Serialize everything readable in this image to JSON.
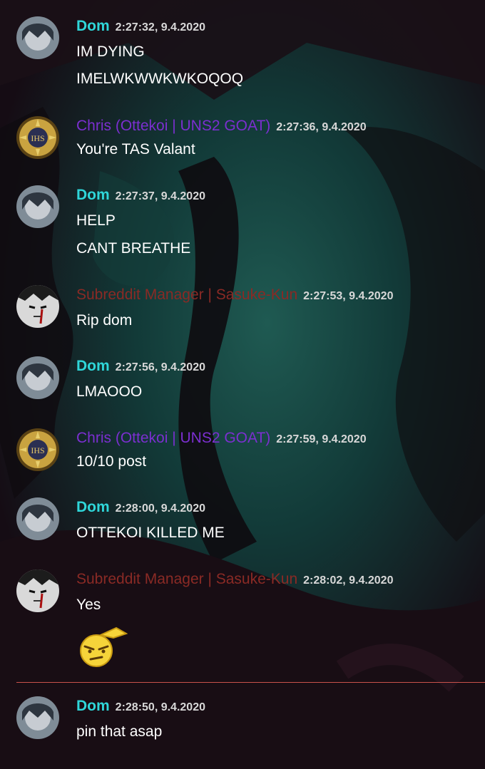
{
  "messages": [
    {
      "author": "Dom",
      "time": "2:27:32, 9.4.2020",
      "lines": [
        "IM DYING",
        "IMELWKWWKWKOQOQ"
      ]
    },
    {
      "author": "Chris (Ottekoi | UNS2 GOAT)",
      "time": "2:27:36, 9.4.2020",
      "lines": [
        "You're TAS Valant"
      ]
    },
    {
      "author": "Dom",
      "time": "2:27:37, 9.4.2020",
      "lines": [
        "HELP",
        "CANT BREATHE"
      ]
    },
    {
      "author": "Subreddit Manager | Sasuke-Kun",
      "time": "2:27:53, 9.4.2020",
      "lines": [
        "Rip dom"
      ]
    },
    {
      "author": "Dom",
      "time": "2:27:56, 9.4.2020",
      "lines": [
        "LMAOOO"
      ]
    },
    {
      "author": "Chris (Ottekoi | UNS2 GOAT)",
      "time": "2:27:59, 9.4.2020",
      "lines": [
        "10/10 post"
      ]
    },
    {
      "author": "Dom",
      "time": "2:28:00, 9.4.2020",
      "lines": [
        "OTTEKOI KILLED ME"
      ]
    },
    {
      "author": "Subreddit Manager | Sasuke-Kun",
      "time": "2:28:02, 9.4.2020",
      "lines": [
        "Yes"
      ],
      "emoji": "thinking-face-emoji"
    },
    {
      "author": "Dom",
      "time": "2:28:50, 9.4.2020",
      "lines": [
        "pin that asap"
      ]
    }
  ],
  "colors": {
    "dom": "#2fd6d9",
    "chris": "#7b2fd0",
    "sasuke": "#8a2a25",
    "divider": "#c9524c"
  }
}
